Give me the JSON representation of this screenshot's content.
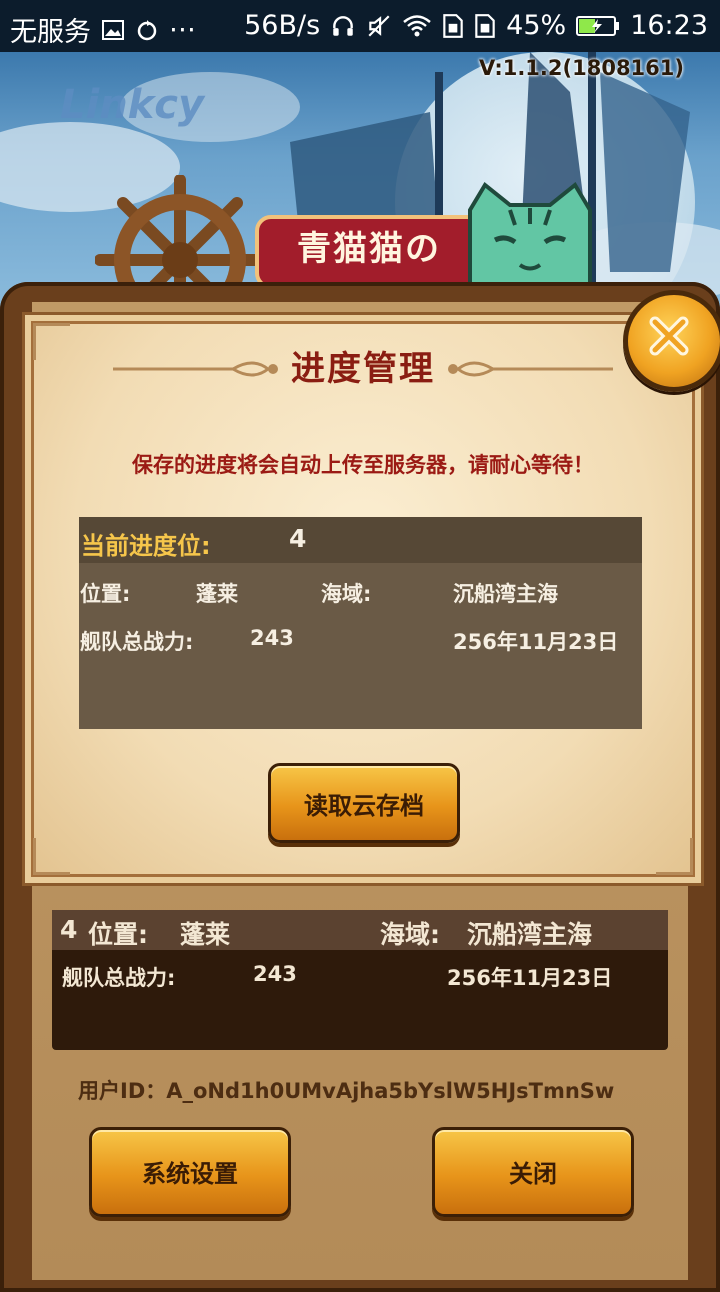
{
  "status_bar": {
    "carrier": "无服务",
    "net_speed": "56B/s",
    "battery": "45%",
    "time": "16:23",
    "icons": [
      "image-icon",
      "sync-icon",
      "more-icon",
      "headphones-icon",
      "mute-icon",
      "wifi-icon",
      "sim1-icon",
      "sim2-icon",
      "battery-icon"
    ]
  },
  "game": {
    "version": "V:1.1.2(1808161)",
    "title_banner": "青猫猫の"
  },
  "dialog": {
    "title": "进度管理",
    "notice": "保存的进度将会自动上传至服务器，请耐心等待！",
    "current_slot_label": "当前进度位:",
    "current_slot_value": "4",
    "location_label": "位置:",
    "location_value": "蓬莱",
    "sea_label": "海域:",
    "sea_value": "沉船湾主海",
    "power_label": "舰队总战力:",
    "power_value": "243",
    "date": "256年11月23日",
    "load_button": "读取云存档"
  },
  "save_slot": {
    "slot_number": "4",
    "location_label": "位置:",
    "location_value": "蓬莱",
    "sea_label": "海域:",
    "sea_value": "沉船湾主海",
    "power_label": "舰队总战力:",
    "power_value": "243",
    "date": "256年11月23日"
  },
  "user_id": "用户ID：A_oNd1h0UMvAjha5bYslW5HJsTmnSw",
  "buttons": {
    "settings": "系统设置",
    "close": "关闭"
  },
  "colors": {
    "title_red": "#8a1d12",
    "notice_red": "#9b1a14",
    "button_orange": "#e7941a",
    "frame_brown": "#6a3f1c"
  }
}
